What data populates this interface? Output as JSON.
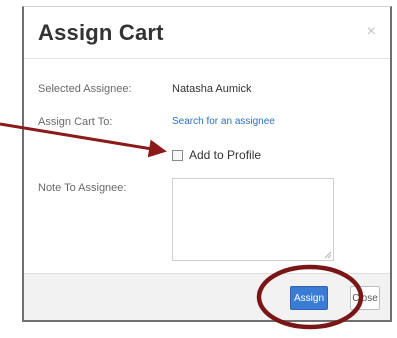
{
  "dialog": {
    "title": "Assign Cart",
    "close_glyph": "×"
  },
  "form": {
    "selected_assignee_label": "Selected Assignee:",
    "selected_assignee_value": "Natasha Aumick",
    "assign_cart_to_label": "Assign Cart To:",
    "assign_cart_to_link": "Search for an assignee",
    "add_to_profile_label": "Add to Profile",
    "add_to_profile_checked": false,
    "note_label": "Note To Assignee:",
    "note_value": ""
  },
  "footer": {
    "assign_label": "Assign",
    "close_label": "Close"
  },
  "colors": {
    "primary_button": "#3a7bd5",
    "link": "#2a72c2",
    "annotation": "#8b1a1a"
  }
}
